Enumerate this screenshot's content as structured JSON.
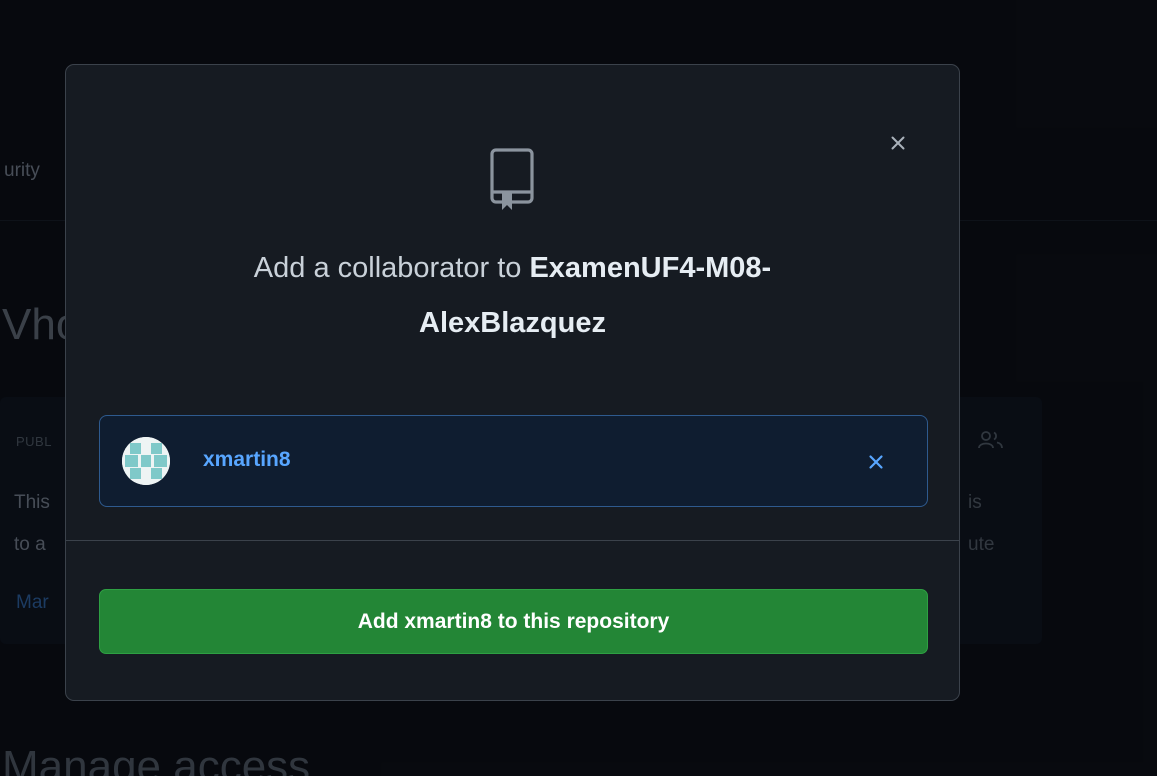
{
  "background": {
    "nav_fragment": "urity",
    "heading_fragment": "Vho",
    "card": {
      "tag_fragment": "PUBL",
      "line1_fragment": "This",
      "line2_fragment": "to a",
      "link_fragment": "Mar",
      "right_line1_fragment": "is",
      "right_line2_fragment": "ute"
    },
    "heading2_fragment": "Manage access"
  },
  "modal": {
    "title_prefix": "Add a collaborator to ",
    "repo_name_line1": "ExamenUF4-M08-",
    "repo_name_line2": "AlexBlazquez",
    "close_icon": "close-icon",
    "repo_icon": "repo-icon"
  },
  "selected_user": {
    "username": "xmartin8",
    "remove_icon": "close-icon"
  },
  "add_button": {
    "label": "Add xmartin8 to this repository"
  },
  "colors": {
    "accent_blue": "#58a6ff",
    "button_green": "#238636",
    "modal_bg": "#161b22"
  }
}
